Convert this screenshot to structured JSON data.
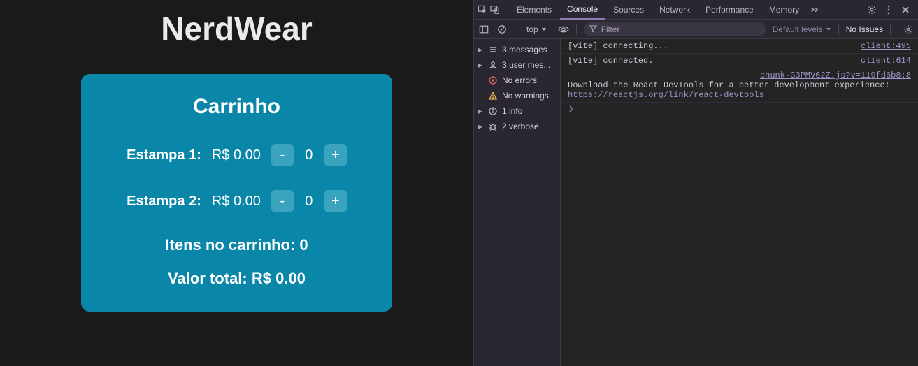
{
  "app": {
    "title": "NerdWear",
    "cart": {
      "title": "Carrinho",
      "items": [
        {
          "label": "Estampa 1:",
          "price": "R$ 0.00",
          "qty": "0"
        },
        {
          "label": "Estampa 2:",
          "price": "R$ 0.00",
          "qty": "0"
        }
      ],
      "minus": "-",
      "plus": "+",
      "items_total": "Itens no carrinho: 0",
      "value_total": "Valor total: R$ 0.00"
    }
  },
  "devtools": {
    "tabs": {
      "elements": "Elements",
      "console": "Console",
      "sources": "Sources",
      "network": "Network",
      "performance": "Performance",
      "memory": "Memory"
    },
    "toolbar": {
      "top": "top",
      "filter_placeholder": "Filter",
      "levels": "Default levels",
      "no_issues": "No Issues"
    },
    "sidebar": {
      "messages": "3 messages",
      "user_messages": "3 user mes...",
      "no_errors": "No errors",
      "no_warnings": "No warnings",
      "info": "1 info",
      "verbose": "2 verbose"
    },
    "logs": {
      "l0_msg": "[vite] connecting...",
      "l0_src": "client:495",
      "l1_msg": "[vite] connected.",
      "l1_src": "client:614",
      "l2_src": "chunk-G3PMV62Z.js?v=119fd6b8:8",
      "l2_msg_a": "Download the React DevTools for a better development experience: ",
      "l2_link": "https://reactjs.org/link/react-devtools"
    }
  }
}
